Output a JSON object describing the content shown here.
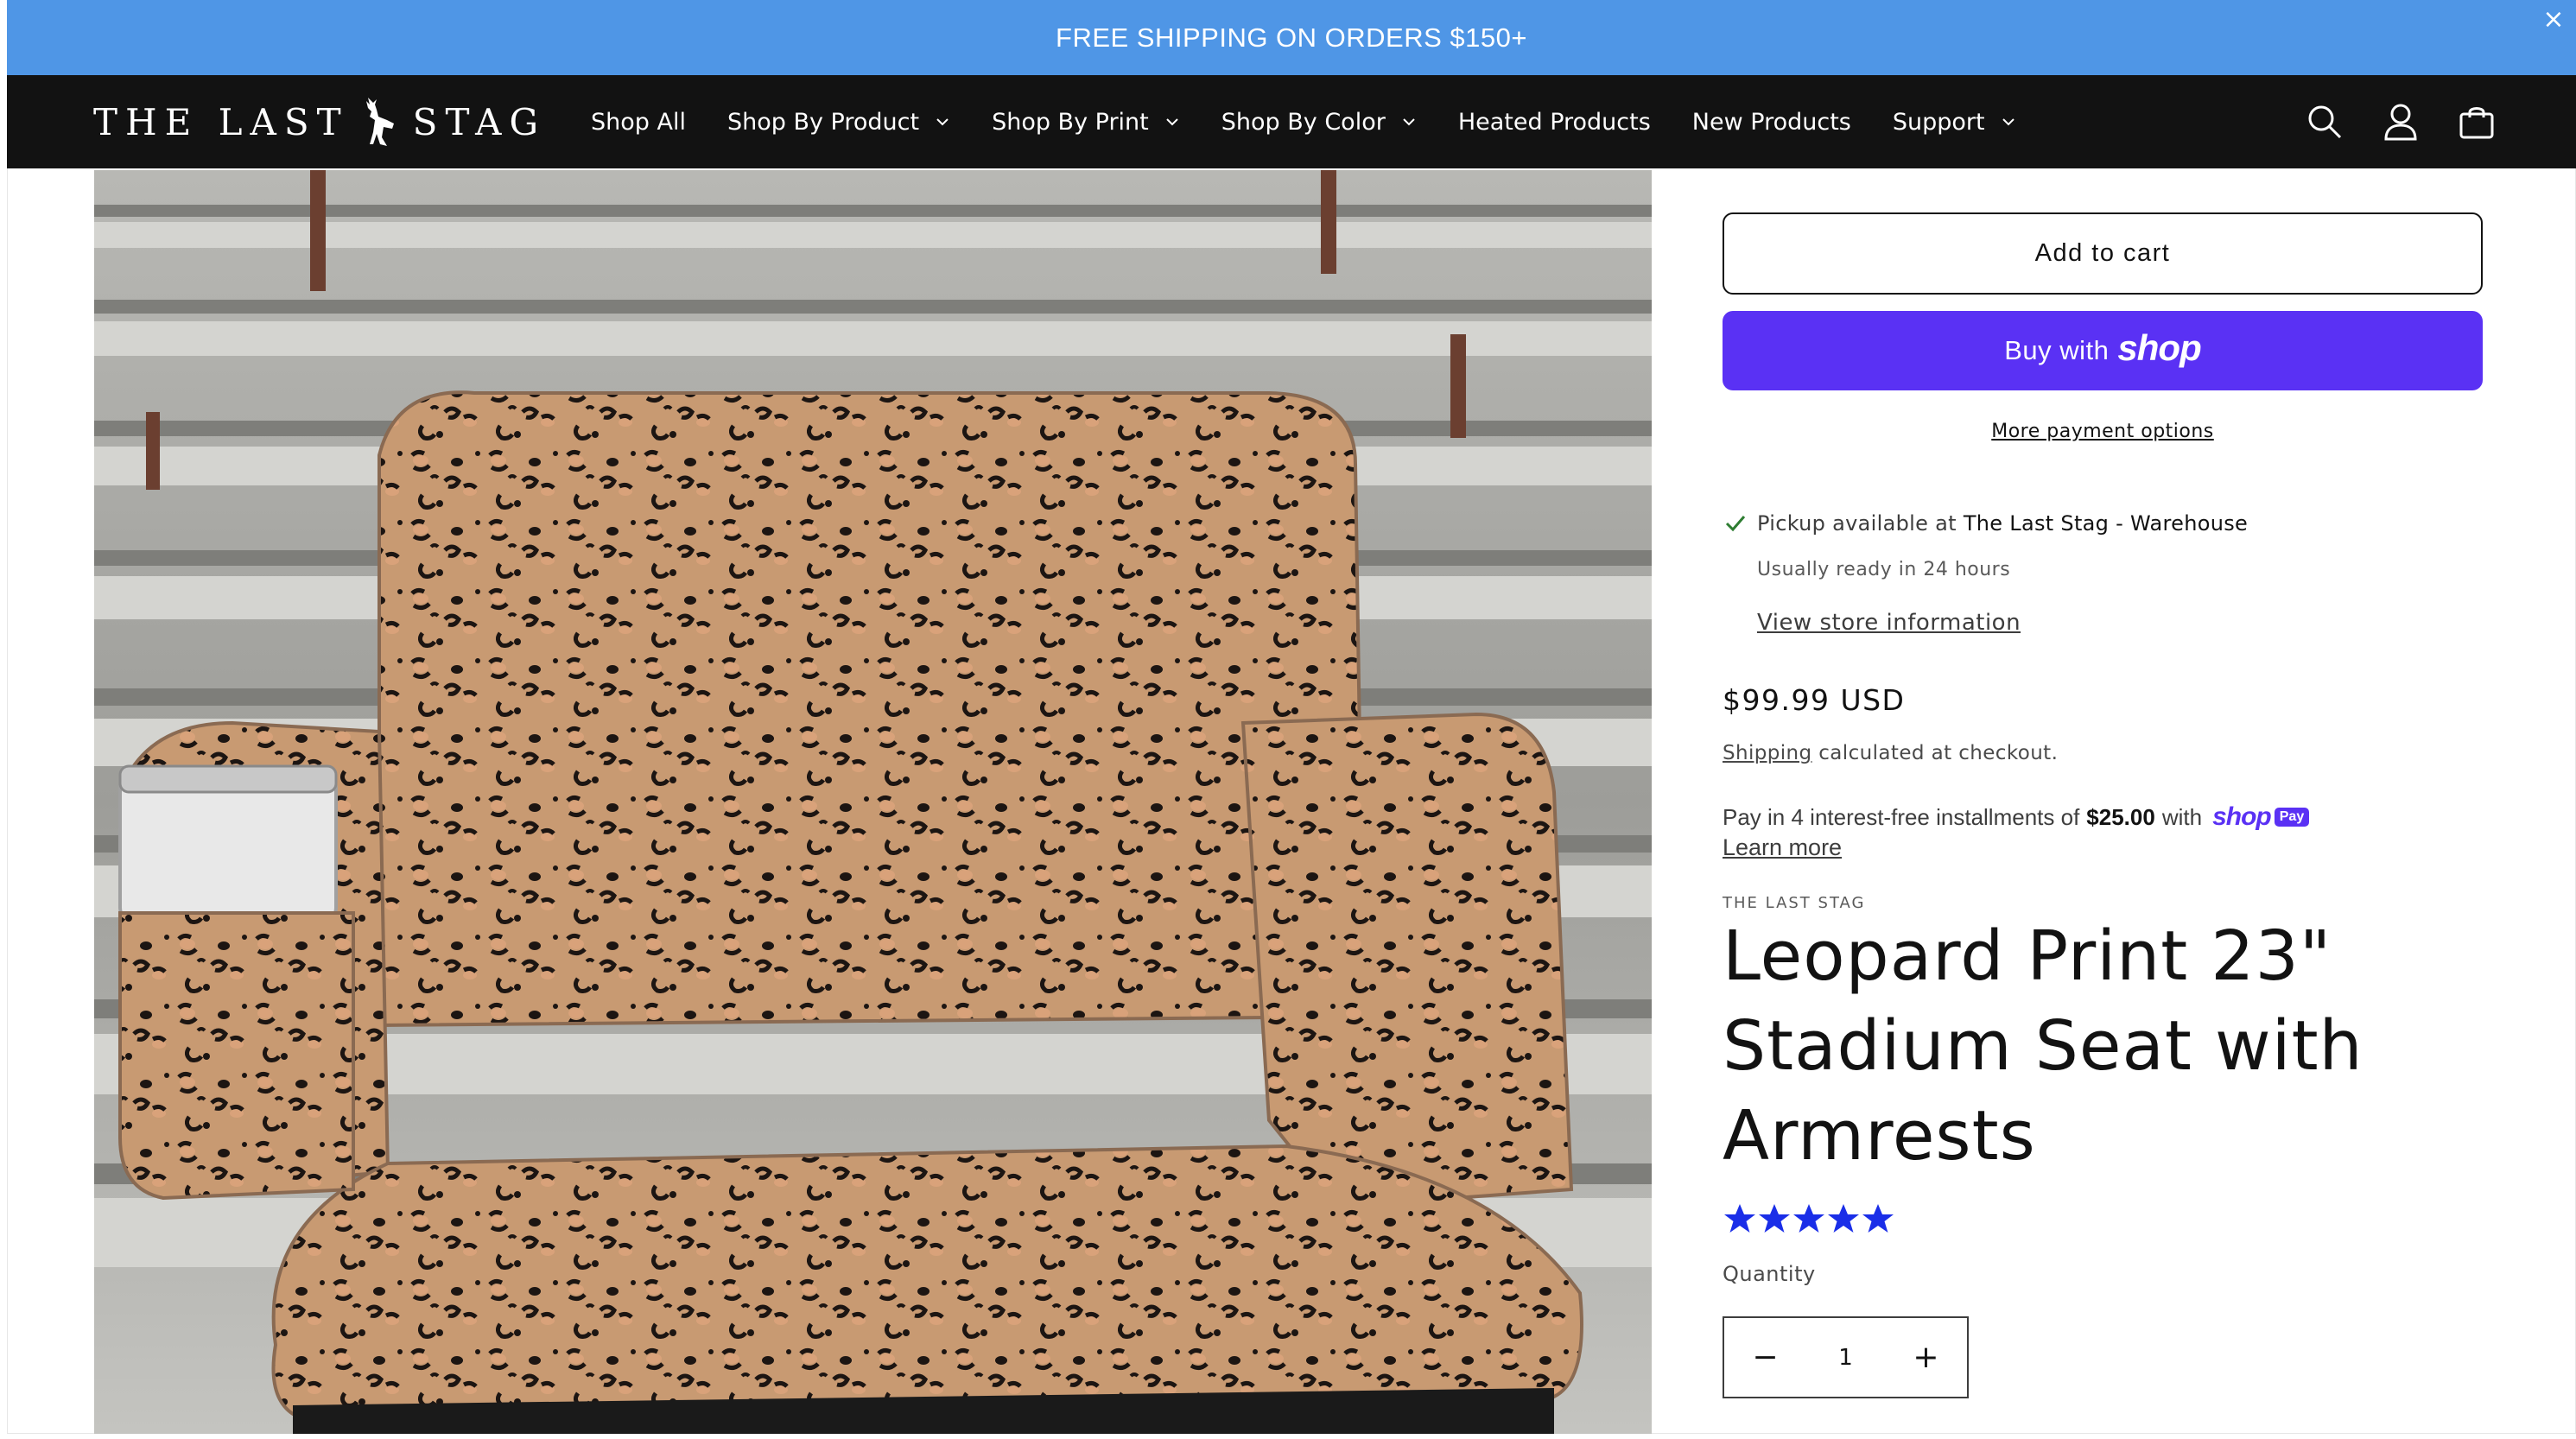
{
  "announcement": {
    "text": "FREE SHIPPING ON ORDERS $150+",
    "close_icon": "close-icon"
  },
  "header": {
    "logo_left": "THE LAST",
    "logo_right": "STAG",
    "nav": [
      {
        "label": "Shop All",
        "has_dropdown": false
      },
      {
        "label": "Shop By Product",
        "has_dropdown": true
      },
      {
        "label": "Shop By Print",
        "has_dropdown": true
      },
      {
        "label": "Shop By Color",
        "has_dropdown": true
      },
      {
        "label": "Heated Products",
        "has_dropdown": false
      },
      {
        "label": "New Products",
        "has_dropdown": false
      },
      {
        "label": "Support",
        "has_dropdown": true
      }
    ],
    "icons": [
      "search-icon",
      "account-icon",
      "cart-icon"
    ]
  },
  "product": {
    "add_to_cart": "Add to cart",
    "buy_with": "Buy with",
    "buy_brand": "shop",
    "more_payment": "More payment options",
    "pickup_prefix": "Pickup available at",
    "pickup_location": "The Last Stag - Warehouse",
    "ready": "Usually ready in 24 hours",
    "store_info": "View store information",
    "price": "$99.99 USD",
    "shipping_link": "Shipping",
    "shipping_rest": "calculated at checkout.",
    "installments_prefix": "Pay in 4 interest-free installments of",
    "installments_amount": "$25.00",
    "installments_with": "with",
    "shop_pay_word": "shop",
    "shop_pay_badge": "Pay",
    "learn_more": "Learn more",
    "vendor": "THE LAST STAG",
    "title": "Leopard Print 23\" Stadium Seat with Armrests",
    "rating": 5,
    "rating_max": 5,
    "quantity_label": "Quantity",
    "quantity_value": "1",
    "minus": "−",
    "plus": "+"
  },
  "colors": {
    "announcement_bg": "#4f96e6",
    "header_bg": "#121212",
    "shop_purple": "#5a31f4",
    "star_blue": "#1a2ee8",
    "check_green": "#2e7d32"
  }
}
